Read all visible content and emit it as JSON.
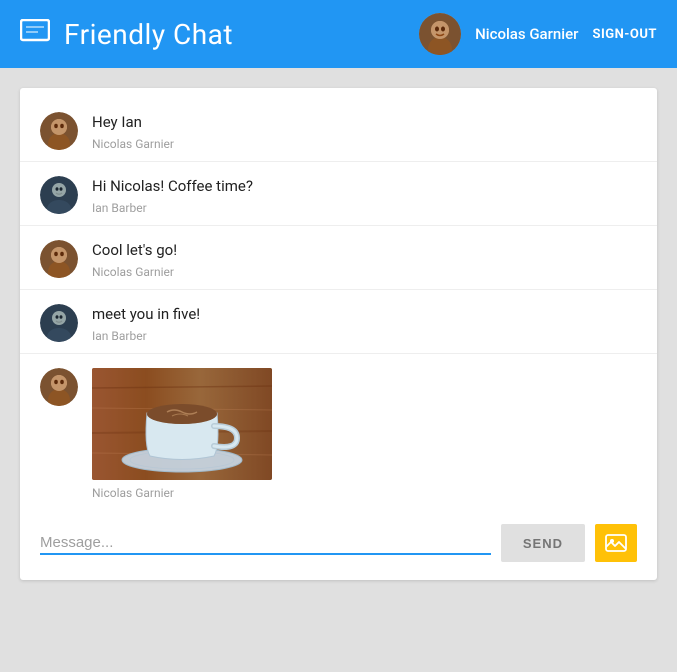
{
  "header": {
    "app_icon": "💬",
    "title": "Friendly Chat",
    "user": {
      "name": "Nicolas Garnier",
      "signout_label": "SIGN-OUT"
    }
  },
  "messages": [
    {
      "id": 1,
      "text": "Hey Ian",
      "sender": "Nicolas Garnier",
      "avatar_type": "nicolas"
    },
    {
      "id": 2,
      "text": "Hi Nicolas! Coffee time?",
      "sender": "Ian Barber",
      "avatar_type": "ian"
    },
    {
      "id": 3,
      "text": "Cool let's go!",
      "sender": "Nicolas Garnier",
      "avatar_type": "nicolas"
    },
    {
      "id": 4,
      "text": "meet you in five!",
      "sender": "Ian Barber",
      "avatar_type": "ian"
    },
    {
      "id": 5,
      "text": "",
      "sender": "Nicolas Garnier",
      "avatar_type": "nicolas",
      "has_image": true
    }
  ],
  "input": {
    "placeholder": "Message...",
    "send_label": "SEND"
  }
}
